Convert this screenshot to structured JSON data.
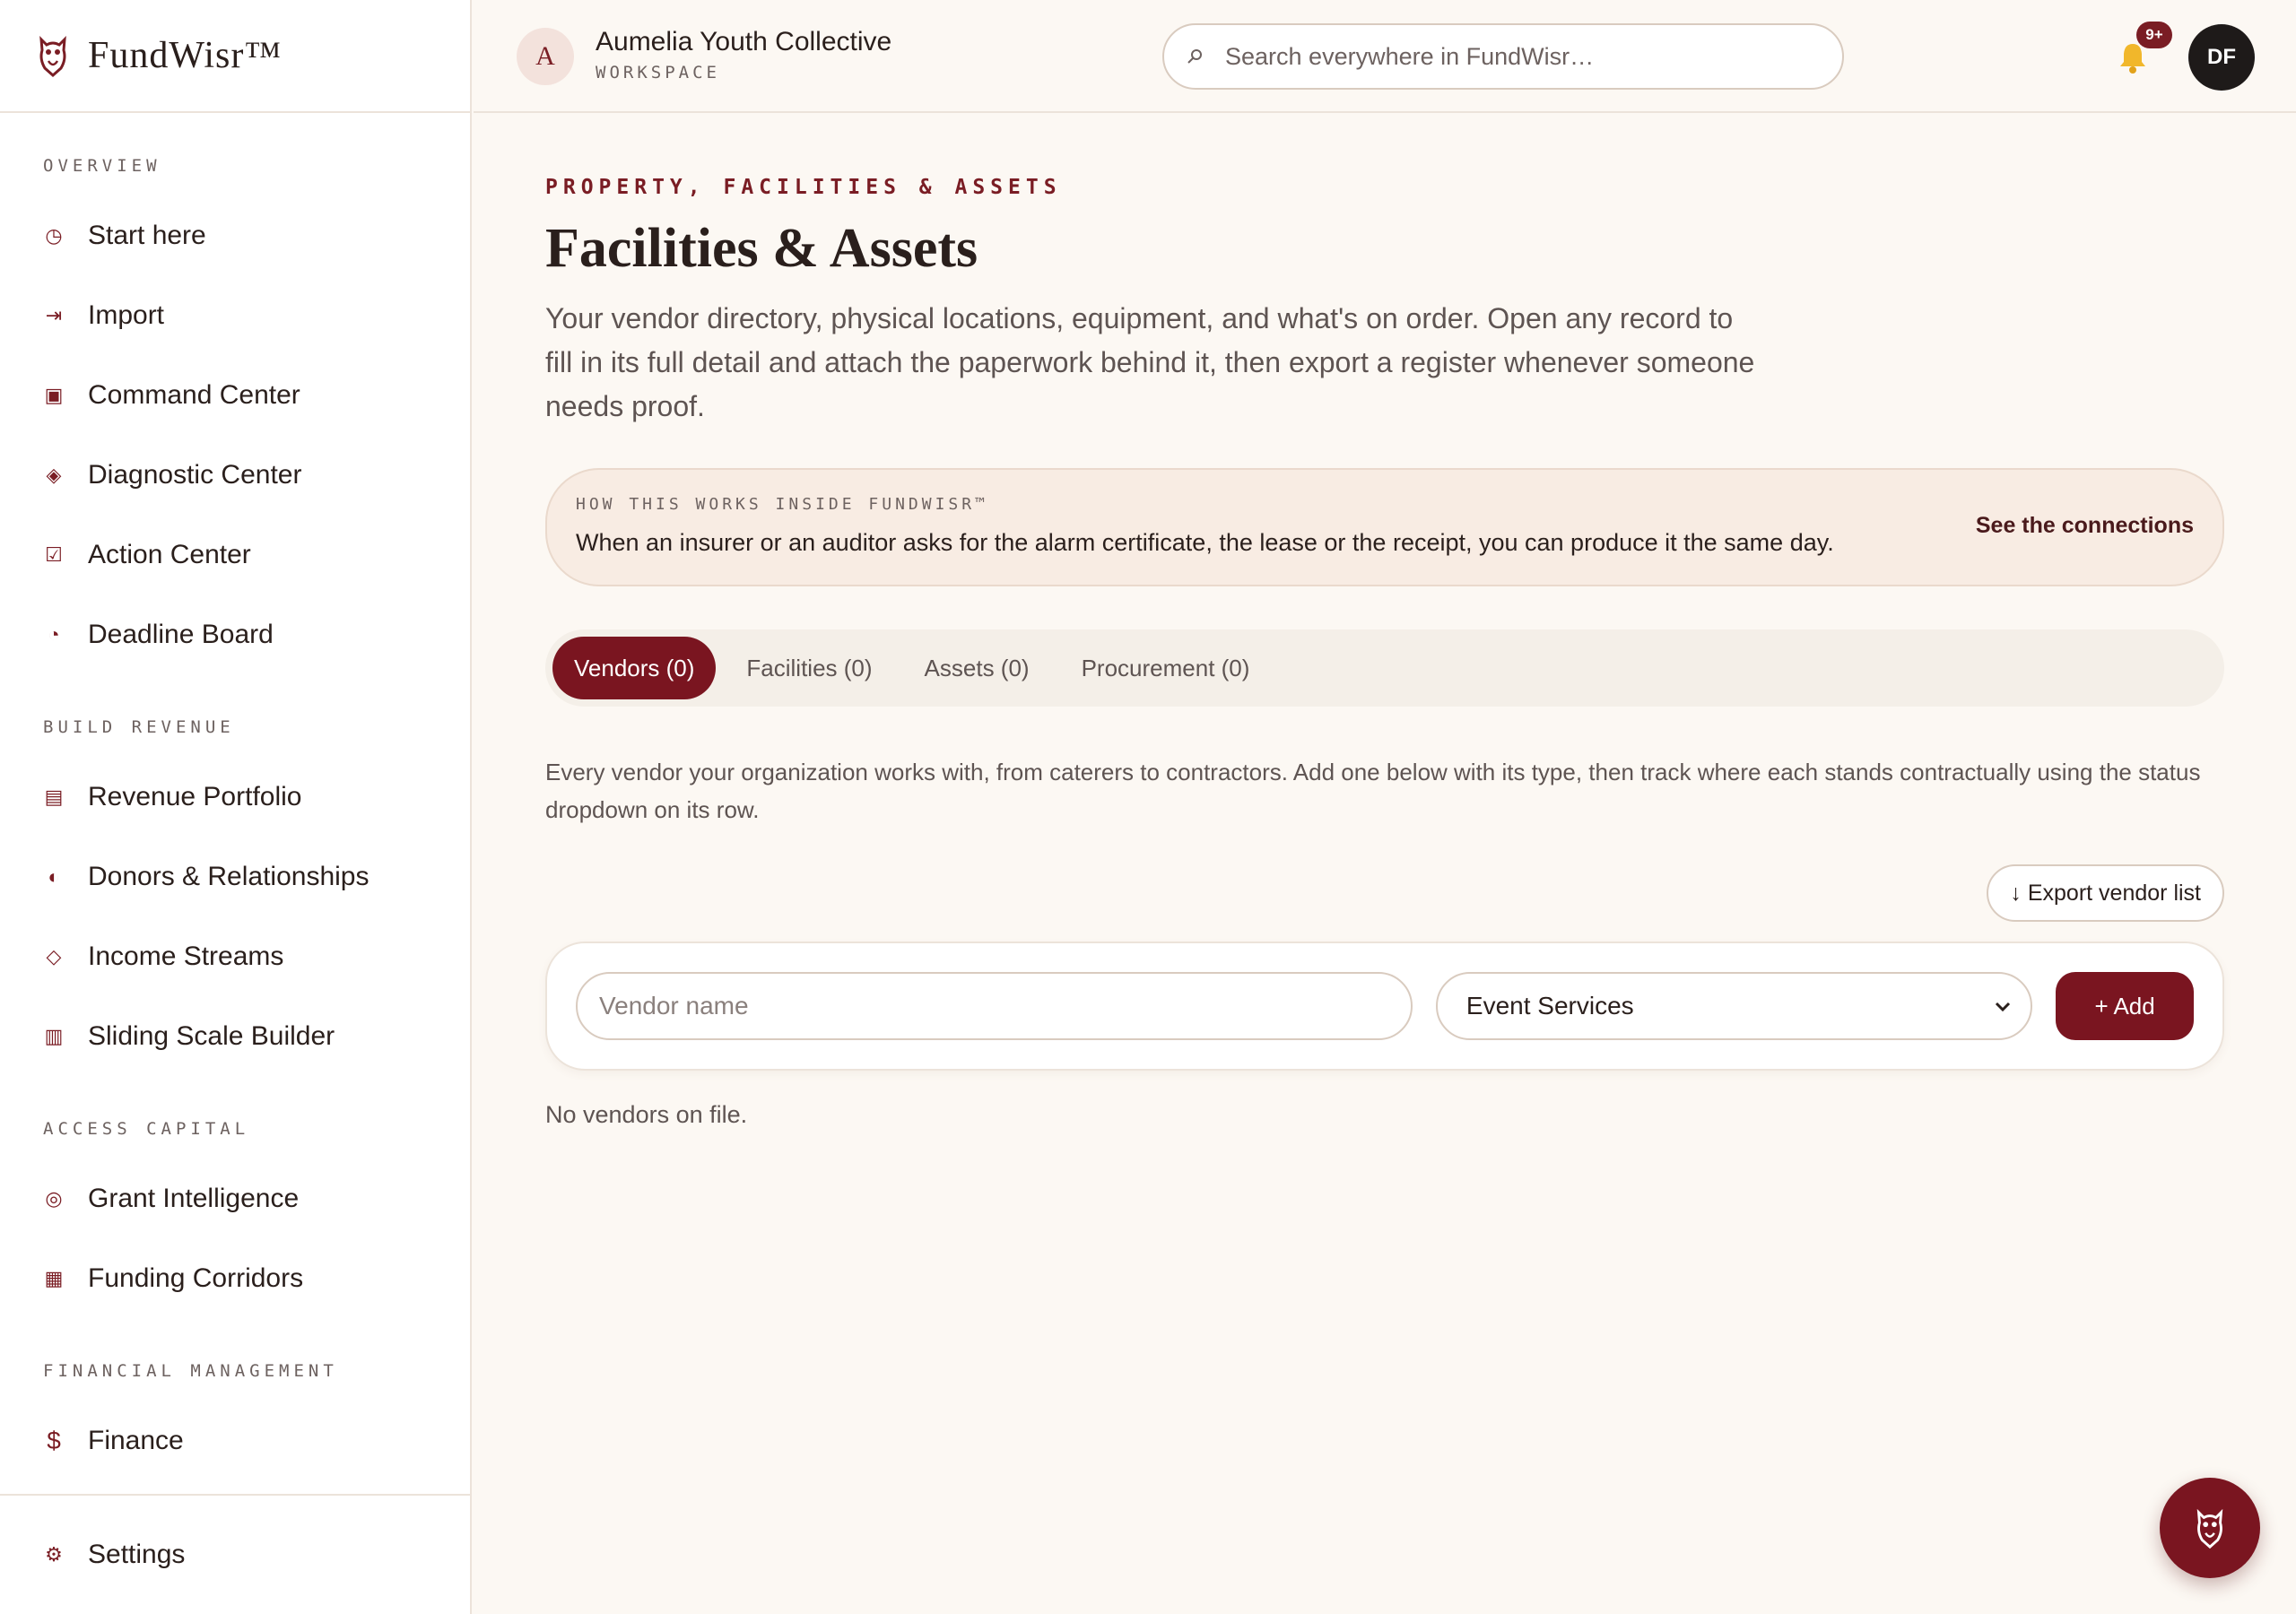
{
  "brand": {
    "name": "FundWisr™",
    "accent": "#7a1520"
  },
  "sidebar": {
    "sections": [
      {
        "label": "OVERVIEW",
        "items": [
          {
            "label": "Start here",
            "icon": "clock-icon"
          },
          {
            "label": "Import",
            "icon": "import-arrow-icon"
          },
          {
            "label": "Command Center",
            "icon": "square-target-icon"
          },
          {
            "label": "Diagnostic Center",
            "icon": "diamond-dot-icon"
          },
          {
            "label": "Action Center",
            "icon": "checkbox-icon"
          },
          {
            "label": "Deadline Board",
            "icon": "pie-icon"
          }
        ]
      },
      {
        "label": "BUILD REVENUE",
        "items": [
          {
            "label": "Revenue Portfolio",
            "icon": "stack-icon"
          },
          {
            "label": "Donors & Relationships",
            "icon": "half-circle-icon"
          },
          {
            "label": "Income Streams",
            "icon": "diamond-icon"
          },
          {
            "label": "Sliding Scale Builder",
            "icon": "columns-icon"
          }
        ]
      },
      {
        "label": "ACCESS CAPITAL",
        "items": [
          {
            "label": "Grant Intelligence",
            "icon": "target-icon"
          },
          {
            "label": "Funding Corridors",
            "icon": "grid-icon"
          }
        ]
      },
      {
        "label": "FINANCIAL MANAGEMENT",
        "items": [
          {
            "label": "Finance",
            "icon": "dollar-icon"
          }
        ]
      }
    ],
    "footer": {
      "label": "Settings",
      "icon": "gear-icon"
    }
  },
  "topbar": {
    "workspace_initial": "A",
    "workspace_name": "Aumelia Youth Collective",
    "workspace_sub": "WORKSPACE",
    "search_placeholder": "Search everywhere in FundWisr…",
    "notification_count": "9+",
    "user_initials": "DF"
  },
  "main": {
    "eyebrow": "PROPERTY, FACILITIES & ASSETS",
    "title": "Facilities & Assets",
    "intro": "Your vendor directory, physical locations, equipment, and what's on order. Open any record to fill in its full detail and attach the paperwork behind it, then export a register whenever someone needs proof.",
    "info": {
      "eyebrow": "HOW THIS WORKS INSIDE FUNDWISR™",
      "text": "When an insurer or an auditor asks for the alarm certificate, the lease or the receipt, you can produce it the same day.",
      "link": "See the connections"
    },
    "tabs": [
      {
        "label": "Vendors (0)",
        "active": true
      },
      {
        "label": "Facilities (0)",
        "active": false
      },
      {
        "label": "Assets (0)",
        "active": false
      },
      {
        "label": "Procurement (0)",
        "active": false
      }
    ],
    "description": "Every vendor your organization works with, from caterers to contractors. Add one below with its type, then track where each stands contractually using the status dropdown on its row.",
    "export_label": "↓ Export vendor list",
    "form": {
      "name_placeholder": "Vendor name",
      "type_value": "Event Services",
      "add_label": "+ Add"
    },
    "empty_text": "No vendors on file."
  }
}
